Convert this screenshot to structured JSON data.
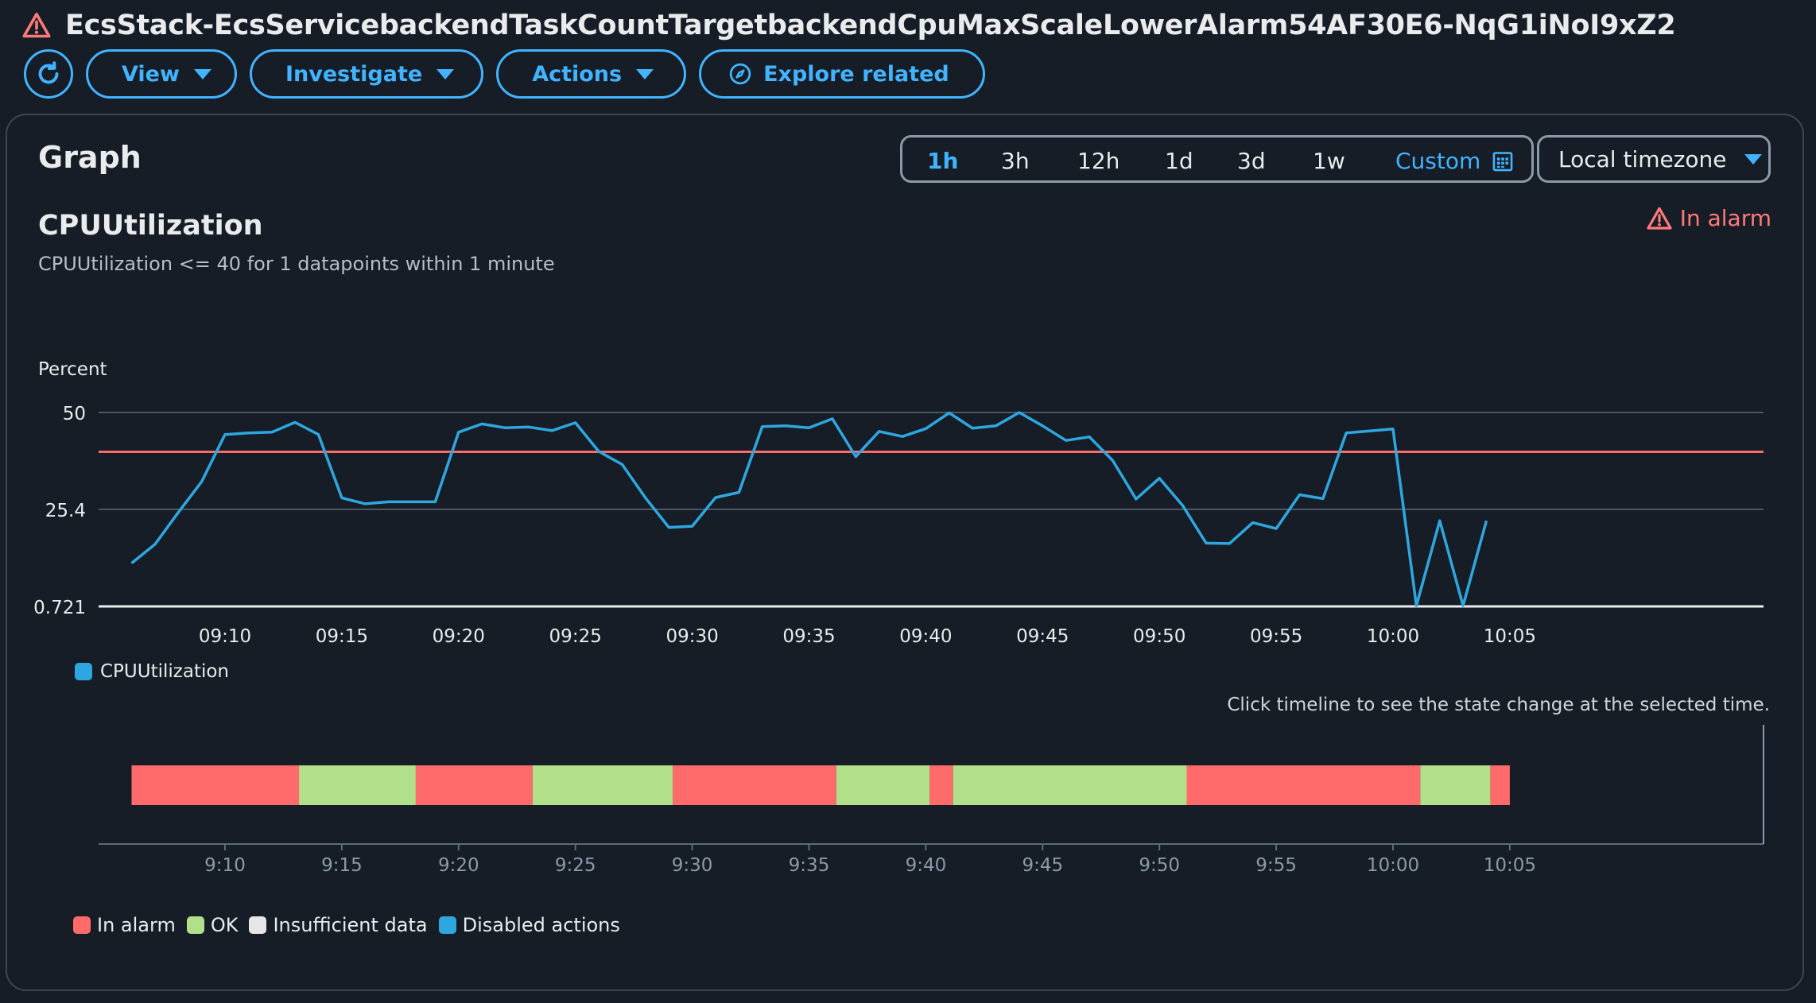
{
  "header": {
    "title": "EcsStack-EcsServicebackendTaskCountTargetbackendCpuMaxScaleLowerAlarm54AF30E6-NqG1iNoI9xZ2",
    "icon": "alarm-warning-icon"
  },
  "toolbar": {
    "refresh_icon": "refresh-icon",
    "view": "View",
    "investigate": "Investigate",
    "actions": "Actions",
    "explore_related": "Explore related"
  },
  "panel": {
    "title": "Graph",
    "time_ranges": [
      "1h",
      "3h",
      "12h",
      "1d",
      "3d",
      "1w"
    ],
    "active_range": "1h",
    "custom": "Custom",
    "timezone": "Local timezone"
  },
  "metric": {
    "title": "CPUUtilization",
    "subtitle": "CPUUtilization <= 40 for 1 datapoints within 1 minute",
    "status": "In alarm",
    "unit": "Percent",
    "legend": "CPUUtilization"
  },
  "colors": {
    "series": "#2ea7e0",
    "threshold": "#ff6b6b",
    "in_alarm": "#ff6b6b",
    "ok": "#b2df8a",
    "insufficient": "#e6e6e6",
    "disabled": "#2ea7e0"
  },
  "chart_data": {
    "type": "line",
    "title": "CPUUtilization",
    "ylabel": "Percent",
    "y_ticks": [
      "0.721",
      "25.4",
      "50"
    ],
    "ylim": [
      0.721,
      50
    ],
    "threshold": 40,
    "x_ticks": [
      "09:10",
      "09:15",
      "09:20",
      "09:25",
      "09:30",
      "09:35",
      "09:40",
      "09:45",
      "09:50",
      "09:55",
      "10:00",
      "10:05"
    ],
    "series": [
      {
        "name": "CPUUtilization",
        "x": [
          "09:06",
          "09:07",
          "09:08",
          "09:09",
          "09:10",
          "09:11",
          "09:12",
          "09:13",
          "09:14",
          "09:15",
          "09:16",
          "09:17",
          "09:18",
          "09:19",
          "09:20",
          "09:21",
          "09:22",
          "09:23",
          "09:24",
          "09:25",
          "09:26",
          "09:27",
          "09:28",
          "09:29",
          "09:30",
          "09:31",
          "09:32",
          "09:33",
          "09:34",
          "09:35",
          "09:36",
          "09:37",
          "09:38",
          "09:39",
          "09:40",
          "09:41",
          "09:42",
          "09:43",
          "09:44",
          "09:45",
          "09:46",
          "09:47",
          "09:48",
          "09:49",
          "09:50",
          "09:51",
          "09:52",
          "09:53",
          "09:54",
          "09:55",
          "09:56",
          "09:57",
          "09:58",
          "09:59",
          "10:00",
          "10:01",
          "10:02",
          "10:03",
          "10:04"
        ],
        "values": [
          11.7,
          16.5,
          24.6,
          32.4,
          44.4,
          44.8,
          45.0,
          47.5,
          44.4,
          28.3,
          26.8,
          27.3,
          27.3,
          27.3,
          45.0,
          47.1,
          46.1,
          46.3,
          45.4,
          47.4,
          40.1,
          36.8,
          28.3,
          20.8,
          21.1,
          28.4,
          29.7,
          46.4,
          46.6,
          46.1,
          48.4,
          38.8,
          45.2,
          43.9,
          45.9,
          49.9,
          46.0,
          46.6,
          50.0,
          46.6,
          42.9,
          43.8,
          37.8,
          28.0,
          33.3,
          26.3,
          16.8,
          16.7,
          22.0,
          20.5,
          29.1,
          28.1,
          44.8,
          45.3,
          45.8,
          0.9,
          22.5,
          0.9,
          22.5
        ]
      }
    ]
  },
  "timeline": {
    "hint": "Click timeline to see the state change at the selected time.",
    "x_ticks": [
      "9:10",
      "9:15",
      "9:20",
      "9:25",
      "9:30",
      "9:35",
      "9:40",
      "9:45",
      "9:50",
      "9:55",
      "10:00",
      "10:05"
    ],
    "segments": [
      {
        "state": "In alarm",
        "start": "09:06",
        "end": "09:13:10"
      },
      {
        "state": "OK",
        "start": "09:13:10",
        "end": "09:18:10"
      },
      {
        "state": "In alarm",
        "start": "09:18:10",
        "end": "09:23:10"
      },
      {
        "state": "OK",
        "start": "09:23:10",
        "end": "09:29:10"
      },
      {
        "state": "In alarm",
        "start": "09:29:10",
        "end": "09:36:10"
      },
      {
        "state": "OK",
        "start": "09:36:10",
        "end": "09:40:10"
      },
      {
        "state": "In alarm",
        "start": "09:40:10",
        "end": "09:41:10"
      },
      {
        "state": "OK",
        "start": "09:41:10",
        "end": "09:51:10"
      },
      {
        "state": "In alarm",
        "start": "09:51:10",
        "end": "10:01:10"
      },
      {
        "state": "OK",
        "start": "10:01:10",
        "end": "10:04:10"
      },
      {
        "state": "In alarm",
        "start": "10:04:10",
        "end": "10:05"
      }
    ],
    "legend": [
      "In alarm",
      "OK",
      "Insufficient data",
      "Disabled actions"
    ]
  }
}
